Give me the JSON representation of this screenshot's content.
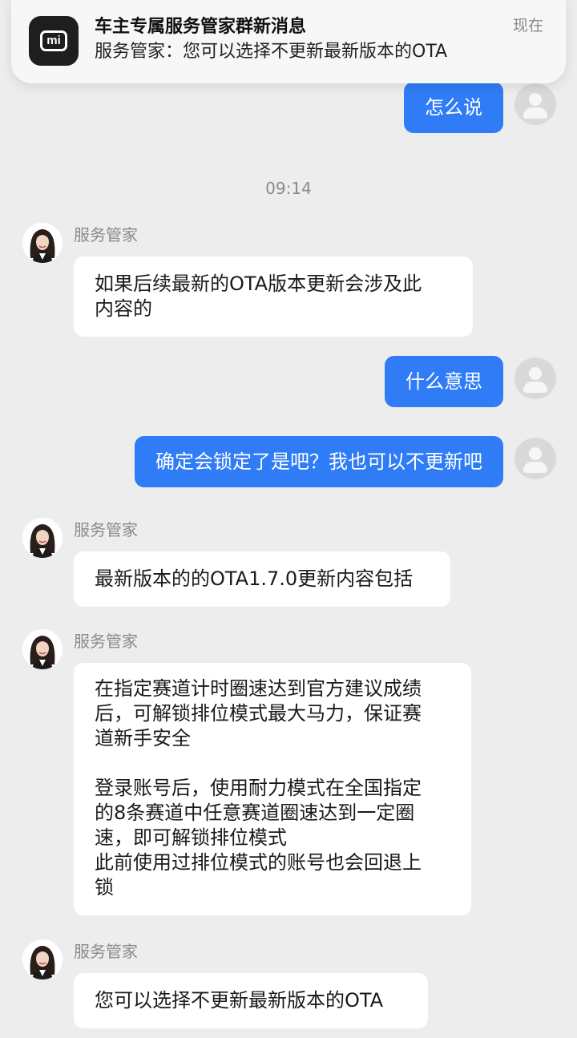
{
  "notification": {
    "app_icon": "xiaomi-mi-logo",
    "app_icon_text": "mi",
    "title": "车主专属服务管家群新消息",
    "body": "服务管家：您可以选择不更新最新版本的OTA",
    "time": "现在"
  },
  "chat": {
    "timestamp": "09:14",
    "agent_name": "服务管家",
    "messages": [
      {
        "side": "out",
        "text": "怎么说"
      },
      {
        "side": "in",
        "sender": "服务管家",
        "text": "如果后续最新的OTA版本更新会涉及此\n内容的"
      },
      {
        "side": "out",
        "text": "什么意思"
      },
      {
        "side": "out",
        "text": "确定会锁定了是吧？我也可以不更新吧"
      },
      {
        "side": "in",
        "sender": "服务管家",
        "text": "最新版本的的OTA1.7.0更新内容包括"
      },
      {
        "side": "in",
        "sender": "服务管家",
        "text": "在指定赛道计时圈速达到官方建议成绩\n后，可解锁排位模式最大马力，保证赛\n道新手安全\n\n登录账号后，使用耐力模式在全国指定\n的8条赛道中任意赛道圈速达到一定圈\n速，即可解锁排位模式\n此前使用过排位模式的账号也会回退上\n锁"
      },
      {
        "side": "in",
        "sender": "服务管家",
        "text": "您可以选择不更新最新版本的OTA"
      }
    ]
  },
  "colors": {
    "background": "#EDEDED",
    "outgoing_bubble": "#2F7CF6",
    "incoming_bubble": "#FFFFFF",
    "meta_text": "#8A8A8A"
  }
}
